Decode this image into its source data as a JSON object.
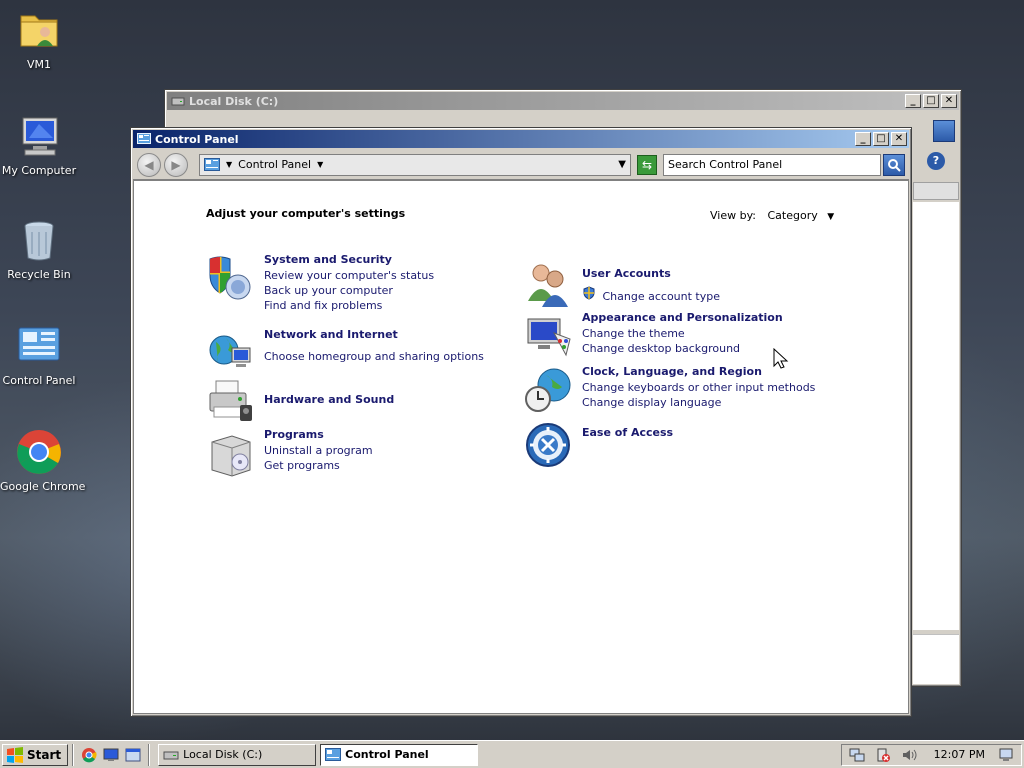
{
  "desktop": {
    "icons": [
      {
        "label": "VM1"
      },
      {
        "label": "My Computer"
      },
      {
        "label": "Recycle Bin"
      },
      {
        "label": "Control Panel"
      },
      {
        "label": "Google Chrome"
      }
    ]
  },
  "back_window": {
    "title": "Local Disk (C:)"
  },
  "control_panel": {
    "title": "Control Panel",
    "address": {
      "crumb": "Control Panel"
    },
    "search": {
      "placeholder": "Search Control Panel"
    },
    "heading": "Adjust your computer's settings",
    "view_by": {
      "label": "View by:",
      "value": "Category"
    },
    "categories": [
      {
        "title": "System and Security",
        "links": [
          "Review your computer's status",
          "Back up your computer",
          "Find and fix problems"
        ]
      },
      {
        "title": "Network and Internet",
        "links": [
          "Choose homegroup and sharing options"
        ]
      },
      {
        "title": "Hardware and Sound",
        "links": []
      },
      {
        "title": "Programs",
        "links": [
          "Uninstall a program",
          "Get programs"
        ]
      },
      {
        "title": "User Accounts",
        "links": [
          "Change account type"
        ]
      },
      {
        "title": "Appearance and Personalization",
        "links": [
          "Change the theme",
          "Change desktop background"
        ]
      },
      {
        "title": "Clock, Language, and Region",
        "links": [
          "Change keyboards or other input methods",
          "Change display language"
        ]
      },
      {
        "title": "Ease of Access",
        "links": []
      }
    ]
  },
  "taskbar": {
    "start_label": "Start",
    "items": [
      {
        "label": "Local Disk (C:)",
        "active": false
      },
      {
        "label": "Control Panel",
        "active": true
      }
    ],
    "clock": "12:07 PM"
  },
  "colors": {
    "title_active": "#0a246a",
    "link": "#1a1a6e",
    "chrome_face": "#d4d0c8"
  }
}
